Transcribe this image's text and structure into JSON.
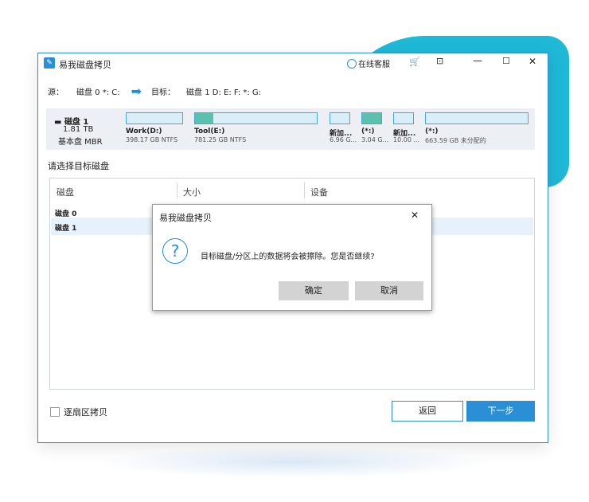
{
  "app": {
    "title": "易我磁盘拷贝",
    "icon_glyph": "✎",
    "service_label": "在线客服",
    "cart_glyph": "🛒",
    "maximize_glyph": "⊡",
    "minimize_glyph": "—",
    "restore_glyph": "☐",
    "close_glyph": "✕",
    "accent_color": "#2b8fd6"
  },
  "source_target": {
    "source_label": "源：",
    "source_value": "磁盘 0 *: C:",
    "arrow_glyph": "➡",
    "target_label": "目标：",
    "target_value": "磁盘 1 D: E: F: *: G:"
  },
  "disk_panel": {
    "name": "磁盘 1",
    "size": "1.81 TB",
    "type": "基本盘 MBR",
    "partitions": [
      {
        "name": "Work(D:)",
        "detail": "398.17 GB NTFS",
        "used_fraction": 0.0
      },
      {
        "name": "Tool(E:)",
        "detail": "781.25 GB NTFS",
        "used_fraction": 0.15
      },
      {
        "name": "新加...",
        "detail": "6.96 G...",
        "used_fraction": 0.0
      },
      {
        "name": "(*:)",
        "detail": "3.04 G...",
        "used_fraction": 1.0
      },
      {
        "name": "新加...",
        "detail": "10.00 ...",
        "used_fraction": 0.0
      },
      {
        "name": "(*:)",
        "detail": "663.59 GB 未分配的",
        "used_fraction": 0.0
      }
    ]
  },
  "choose_target_label": "请选择目标磁盘",
  "disk_list": {
    "columns": [
      "磁盘",
      "大小",
      "设备"
    ],
    "rows": [
      {
        "name": "磁盘 0"
      },
      {
        "name": "磁盘 1"
      }
    ]
  },
  "sector_copy_label": "逐扇区拷贝",
  "buttons": {
    "back": "返回",
    "next": "下一步"
  },
  "dialog": {
    "title": "易我磁盘拷贝",
    "close_glyph": "✕",
    "question_glyph": "?",
    "message": "目标磁盘/分区上的数据将会被擦除。您是否继续?",
    "ok": "确定",
    "cancel": "取消"
  }
}
